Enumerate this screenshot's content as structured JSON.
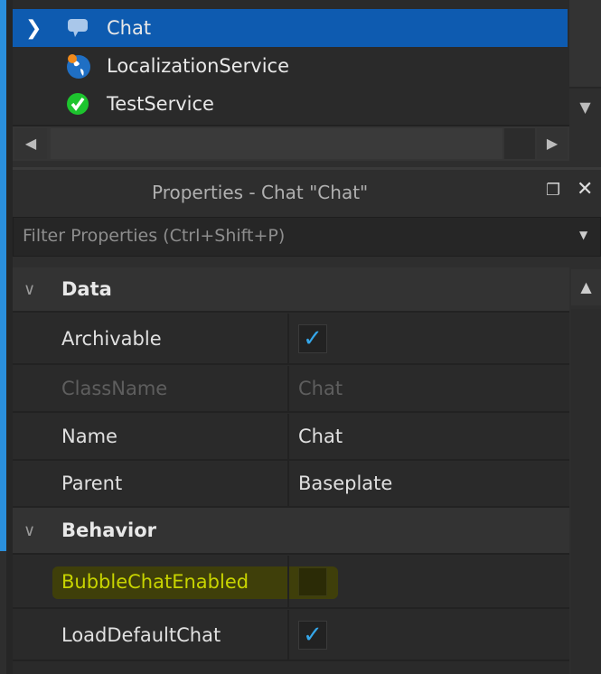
{
  "explorer": {
    "items": [
      {
        "label": "Chat",
        "icon": "chat-bubble-icon",
        "selected": true,
        "expandable": true
      },
      {
        "label": "LocalizationService",
        "icon": "globe-icon"
      },
      {
        "label": "TestService",
        "icon": "green-check-icon"
      }
    ]
  },
  "properties": {
    "title": "Properties - Chat \"Chat\"",
    "filter_placeholder": "Filter Properties (Ctrl+Shift+P)",
    "categories": [
      {
        "name": "Data",
        "rows": [
          {
            "name": "Archivable",
            "type": "checkbox",
            "checked": true
          },
          {
            "name": "ClassName",
            "value": "Chat",
            "readonly": true
          },
          {
            "name": "Name",
            "value": "Chat"
          },
          {
            "name": "Parent",
            "value": "Baseplate"
          }
        ]
      },
      {
        "name": "Behavior",
        "rows": [
          {
            "name": "BubbleChatEnabled",
            "type": "checkbox",
            "checked": false,
            "highlighted": true
          },
          {
            "name": "LoadDefaultChat",
            "type": "checkbox",
            "checked": true
          }
        ]
      }
    ]
  },
  "colors": {
    "selection": "#0e5bb0",
    "checkmark": "#35a7ea",
    "highlight": "#c8d400"
  }
}
